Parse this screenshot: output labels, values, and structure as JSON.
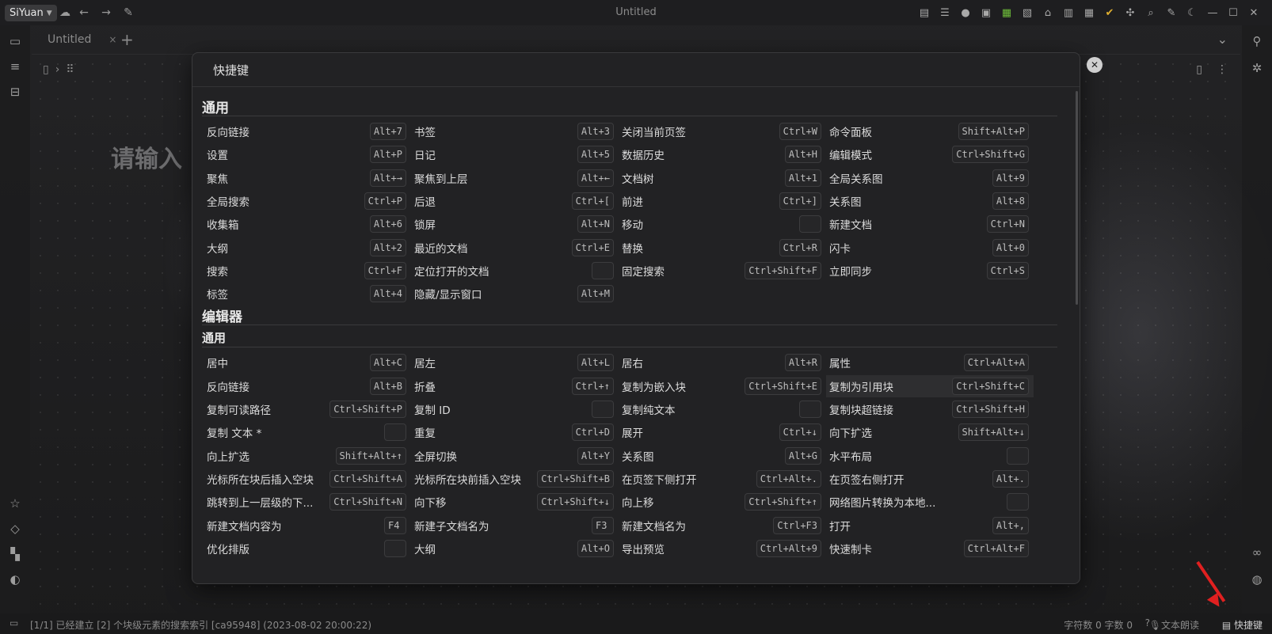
{
  "app": {
    "brand": "SiYuan",
    "window_title": "Untitled"
  },
  "tab": {
    "label": "Untitled",
    "close": "×",
    "add": "+"
  },
  "doc": {
    "title_placeholder": "请输入"
  },
  "dialog": {
    "title": "快捷键",
    "sections": [
      {
        "title": "通用",
        "level": "h2",
        "rows": [
          [
            [
              "反向链接",
              "Alt+7"
            ],
            [
              "书签",
              "Alt+3"
            ],
            [
              "关闭当前页签",
              "Ctrl+W"
            ],
            [
              "命令面板",
              "Shift+Alt+P"
            ]
          ],
          [
            [
              "设置",
              "Alt+P"
            ],
            [
              "日记",
              "Alt+5"
            ],
            [
              "数据历史",
              "Alt+H"
            ],
            [
              "编辑模式",
              "Ctrl+Shift+G"
            ]
          ],
          [
            [
              "聚焦",
              "Alt+→"
            ],
            [
              "聚焦到上层",
              "Alt+←"
            ],
            [
              "文档树",
              "Alt+1"
            ],
            [
              "全局关系图",
              "Alt+9"
            ]
          ],
          [
            [
              "全局搜索",
              "Ctrl+P"
            ],
            [
              "后退",
              "Ctrl+["
            ],
            [
              "前进",
              "Ctrl+]"
            ],
            [
              "关系图",
              "Alt+8"
            ]
          ],
          [
            [
              "收集箱",
              "Alt+6"
            ],
            [
              "锁屏",
              "Alt+N"
            ],
            [
              "移动",
              ""
            ],
            [
              "新建文档",
              "Ctrl+N"
            ]
          ],
          [
            [
              "大纲",
              "Alt+2"
            ],
            [
              "最近的文档",
              "Ctrl+E"
            ],
            [
              "替换",
              "Ctrl+R"
            ],
            [
              "闪卡",
              "Alt+0"
            ]
          ],
          [
            [
              "搜索",
              "Ctrl+F"
            ],
            [
              "定位打开的文档",
              ""
            ],
            [
              "固定搜索",
              "Ctrl+Shift+F"
            ],
            [
              "立即同步",
              "Ctrl+S"
            ]
          ],
          [
            [
              "标签",
              "Alt+4"
            ],
            [
              "隐藏/显示窗口",
              "Alt+M"
            ]
          ]
        ]
      },
      {
        "title": "编辑器",
        "level": "h2",
        "rows": []
      },
      {
        "title": "通用",
        "level": "h3",
        "rows": [
          [
            [
              "居中",
              "Alt+C"
            ],
            [
              "居左",
              "Alt+L"
            ],
            [
              "居右",
              "Alt+R"
            ],
            [
              "属性",
              "Ctrl+Alt+A"
            ]
          ],
          [
            [
              "反向链接",
              "Alt+B"
            ],
            [
              "折叠",
              "Ctrl+↑"
            ],
            [
              "复制为嵌入块",
              "Ctrl+Shift+E"
            ],
            [
              "复制为引用块",
              "Ctrl+Shift+C"
            ]
          ],
          [
            [
              "复制可读路径",
              "Ctrl+Shift+P"
            ],
            [
              "复制 ID",
              ""
            ],
            [
              "复制纯文本",
              ""
            ],
            [
              "复制块超链接",
              "Ctrl+Shift+H"
            ]
          ],
          [
            [
              "复制 文本 *",
              ""
            ],
            [
              "重复",
              "Ctrl+D"
            ],
            [
              "展开",
              "Ctrl+↓"
            ],
            [
              "向下扩选",
              "Shift+Alt+↓"
            ]
          ],
          [
            [
              "向上扩选",
              "Shift+Alt+↑"
            ],
            [
              "全屏切换",
              "Alt+Y"
            ],
            [
              "关系图",
              "Alt+G"
            ],
            [
              "水平布局",
              ""
            ]
          ],
          [
            [
              "光标所在块后插入空块",
              "Ctrl+Shift+A"
            ],
            [
              "光标所在块前插入空块",
              "Ctrl+Shift+B"
            ],
            [
              "在页签下侧打开",
              "Ctrl+Alt+."
            ],
            [
              "在页签右侧打开",
              "Alt+."
            ]
          ],
          [
            [
              "跳转到上一层级的下...",
              "Ctrl+Shift+N"
            ],
            [
              "向下移",
              "Ctrl+Shift+↓"
            ],
            [
              "向上移",
              "Ctrl+Shift+↑"
            ],
            [
              "网络图片转换为本地...",
              ""
            ]
          ],
          [
            [
              "新建文档内容为",
              "F4"
            ],
            [
              "新建子文档名为",
              "F3"
            ],
            [
              "新建文档名为",
              "Ctrl+F3"
            ],
            [
              "打开",
              "Alt+,"
            ]
          ],
          [
            [
              "优化排版",
              ""
            ],
            [
              "大纲",
              "Alt+O"
            ],
            [
              "导出预览",
              "Ctrl+Alt+9"
            ],
            [
              "快速制卡",
              "Ctrl+Alt+F"
            ]
          ]
        ]
      }
    ]
  },
  "status": {
    "message": "[1/1] 已经建立 [2] 个块级元素的搜索索引 [ca95948] (2023-08-02 20:00:22)",
    "counts": "字符数 0  字数 0",
    "help": "?",
    "tts": "文本朗读",
    "shortcuts": "快捷键"
  },
  "highlight_color": "#e02020"
}
